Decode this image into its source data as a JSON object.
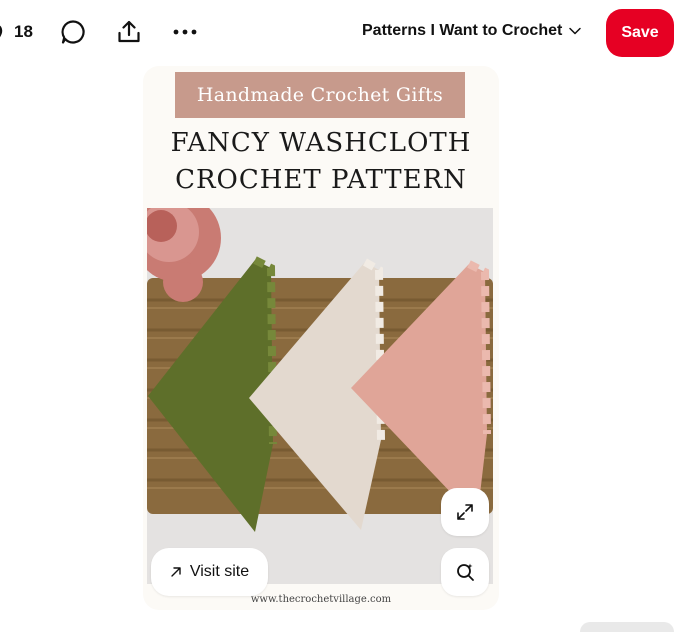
{
  "toolbar": {
    "like_count": "18",
    "icons": [
      "heart-icon",
      "comment-icon",
      "share-icon",
      "more-icon"
    ],
    "board_name": "Patterns I Want to Crochet",
    "save_label": "Save"
  },
  "pin": {
    "banner_text": "Handmade Crochet Gifts",
    "title_line1": "FANCY WASHCLOTH",
    "title_line2": "CROCHET PATTERN",
    "source_url": "www.thecrochetvillage.com",
    "visit_label": "Visit site",
    "washcloth_colors": [
      "#5e6f2a",
      "#e3d9cf",
      "#e0a598"
    ]
  },
  "colors": {
    "save": "#e60023",
    "banner": "#c79a8c"
  }
}
